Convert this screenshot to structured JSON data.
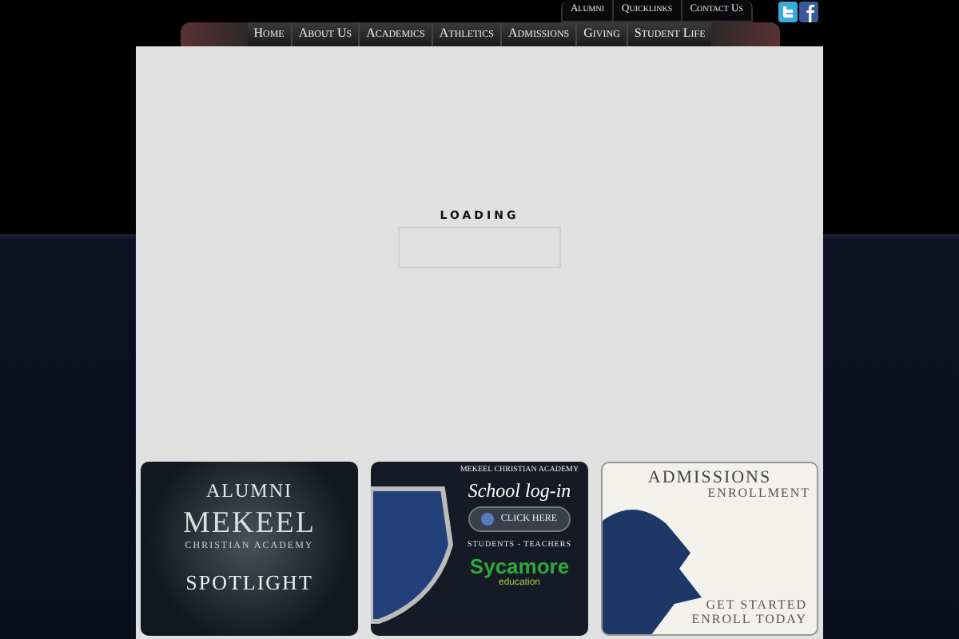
{
  "top_links": [
    {
      "label": "Alumni"
    },
    {
      "label": "Quicklinks"
    },
    {
      "label": "Contact Us"
    }
  ],
  "nav": [
    {
      "label": "Home"
    },
    {
      "label": "About Us"
    },
    {
      "label": "Academics"
    },
    {
      "label": "Athletics"
    },
    {
      "label": "Admissions"
    },
    {
      "label": "Giving"
    },
    {
      "label": "Student Life"
    }
  ],
  "loading": {
    "label": "LOADING"
  },
  "banners": [
    {
      "kind": "alumni",
      "lines": [
        "ALUMNI",
        "MEKEEL",
        "CHRISTIAN ACADEMY",
        "SPOTLIGHT"
      ]
    },
    {
      "kind": "login",
      "lines": [
        "MEKEEL CHRISTIAN ACADEMY",
        "School log-in",
        "CLICK HERE",
        "STUDENTS - TEACHERS",
        "Sycamore",
        "education"
      ]
    },
    {
      "kind": "admissions",
      "lines": [
        "ADMISSIONS",
        "ENROLLMENT",
        "GET STARTED",
        "ENROLL TODAY"
      ]
    }
  ]
}
